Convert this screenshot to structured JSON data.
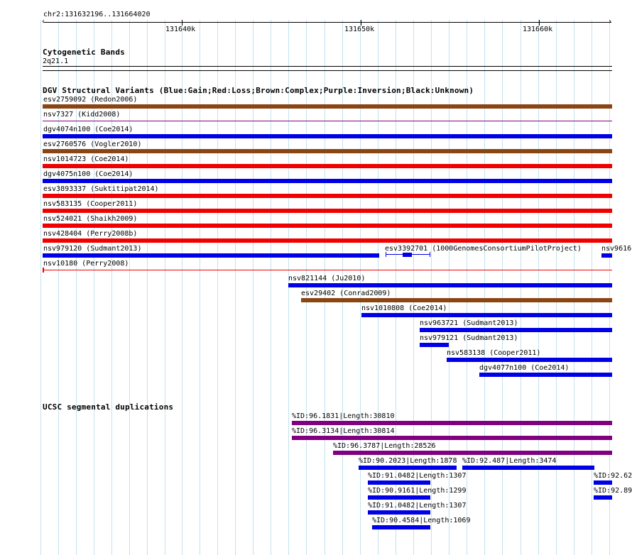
{
  "ruler": {
    "position": "chr2:131632196..131664020",
    "ticks": [
      "131640k",
      "131650k",
      "131660k"
    ]
  },
  "cytoband": {
    "title": "Cytogenetic Bands",
    "band": "2q21.1"
  },
  "dgv": {
    "title": "DGV Structural Variants (Blue:Gain;Red:Loss;Brown:Complex;Purple:Inversion;Black:Unknown)",
    "colors": {
      "gain": "#0000e6",
      "loss": "#f00000",
      "complex": "#8b4513",
      "inversion": "#800080",
      "unknown": "#000000"
    },
    "features": [
      {
        "label": "esv2759092 (Redon2006)",
        "type": "complex"
      },
      {
        "label": "nsv7327 (Kidd2008)",
        "type": "inversion"
      },
      {
        "label": "dgv4074n100 (Coe2014)",
        "type": "gain"
      },
      {
        "label": "esv2760576 (Vogler2010)",
        "type": "complex"
      },
      {
        "label": "nsv1014723 (Coe2014)",
        "type": "loss"
      },
      {
        "label": "dgv4075n100 (Coe2014)",
        "type": "gain"
      },
      {
        "label": "esv3893337 (Suktitipat2014)",
        "type": "loss"
      },
      {
        "label": "nsv583135 (Cooper2011)",
        "type": "loss"
      },
      {
        "label": "nsv524021 (Shaikh2009)",
        "type": "loss"
      },
      {
        "label": "nsv428404 (Perry2008b)",
        "type": "loss"
      },
      {
        "label": "nsv979120 (Sudmant2013)",
        "type": "gain"
      },
      {
        "label": "esv3392701 (1000GenomesConsortiumPilotProject)",
        "type": "gain"
      },
      {
        "label": "nsv9616",
        "type": "gain"
      },
      {
        "label": "nsv10180 (Perry2008)",
        "type": "loss"
      },
      {
        "label": "nsv821144 (Ju2010)",
        "type": "gain"
      },
      {
        "label": "esv29402 (Conrad2009)",
        "type": "complex"
      },
      {
        "label": "nsv1010808 (Coe2014)",
        "type": "gain"
      },
      {
        "label": "nsv963721 (Sudmant2013)",
        "type": "gain"
      },
      {
        "label": "nsv979121 (Sudmant2013)",
        "type": "gain"
      },
      {
        "label": "nsv583138 (Cooper2011)",
        "type": "gain"
      },
      {
        "label": "dgv4077n100 (Coe2014)",
        "type": "gain"
      }
    ]
  },
  "segdup": {
    "title": "UCSC segmental duplications",
    "colors": {
      "high": "#800080",
      "low": "#0000e6"
    },
    "features": [
      {
        "label": "%ID:96.1831|Length:30810",
        "level": "high"
      },
      {
        "label": "%ID:96.3134|Length:30814",
        "level": "high"
      },
      {
        "label": "%ID:96.3787|Length:28526",
        "level": "high"
      },
      {
        "label": "%ID:90.2023|Length:1878",
        "level": "low"
      },
      {
        "label": "%ID:92.487|Length:3474",
        "level": "low"
      },
      {
        "label": "%ID:91.0482|Length:1307",
        "level": "low"
      },
      {
        "label": "%ID:92.62",
        "level": "low"
      },
      {
        "label": "%ID:90.9161|Length:1299",
        "level": "low"
      },
      {
        "label": "%ID:92.89",
        "level": "low"
      },
      {
        "label": "%ID:91.0482|Length:1307",
        "level": "low"
      },
      {
        "label": "%ID:90.4584|Length:1069",
        "level": "low"
      }
    ]
  }
}
